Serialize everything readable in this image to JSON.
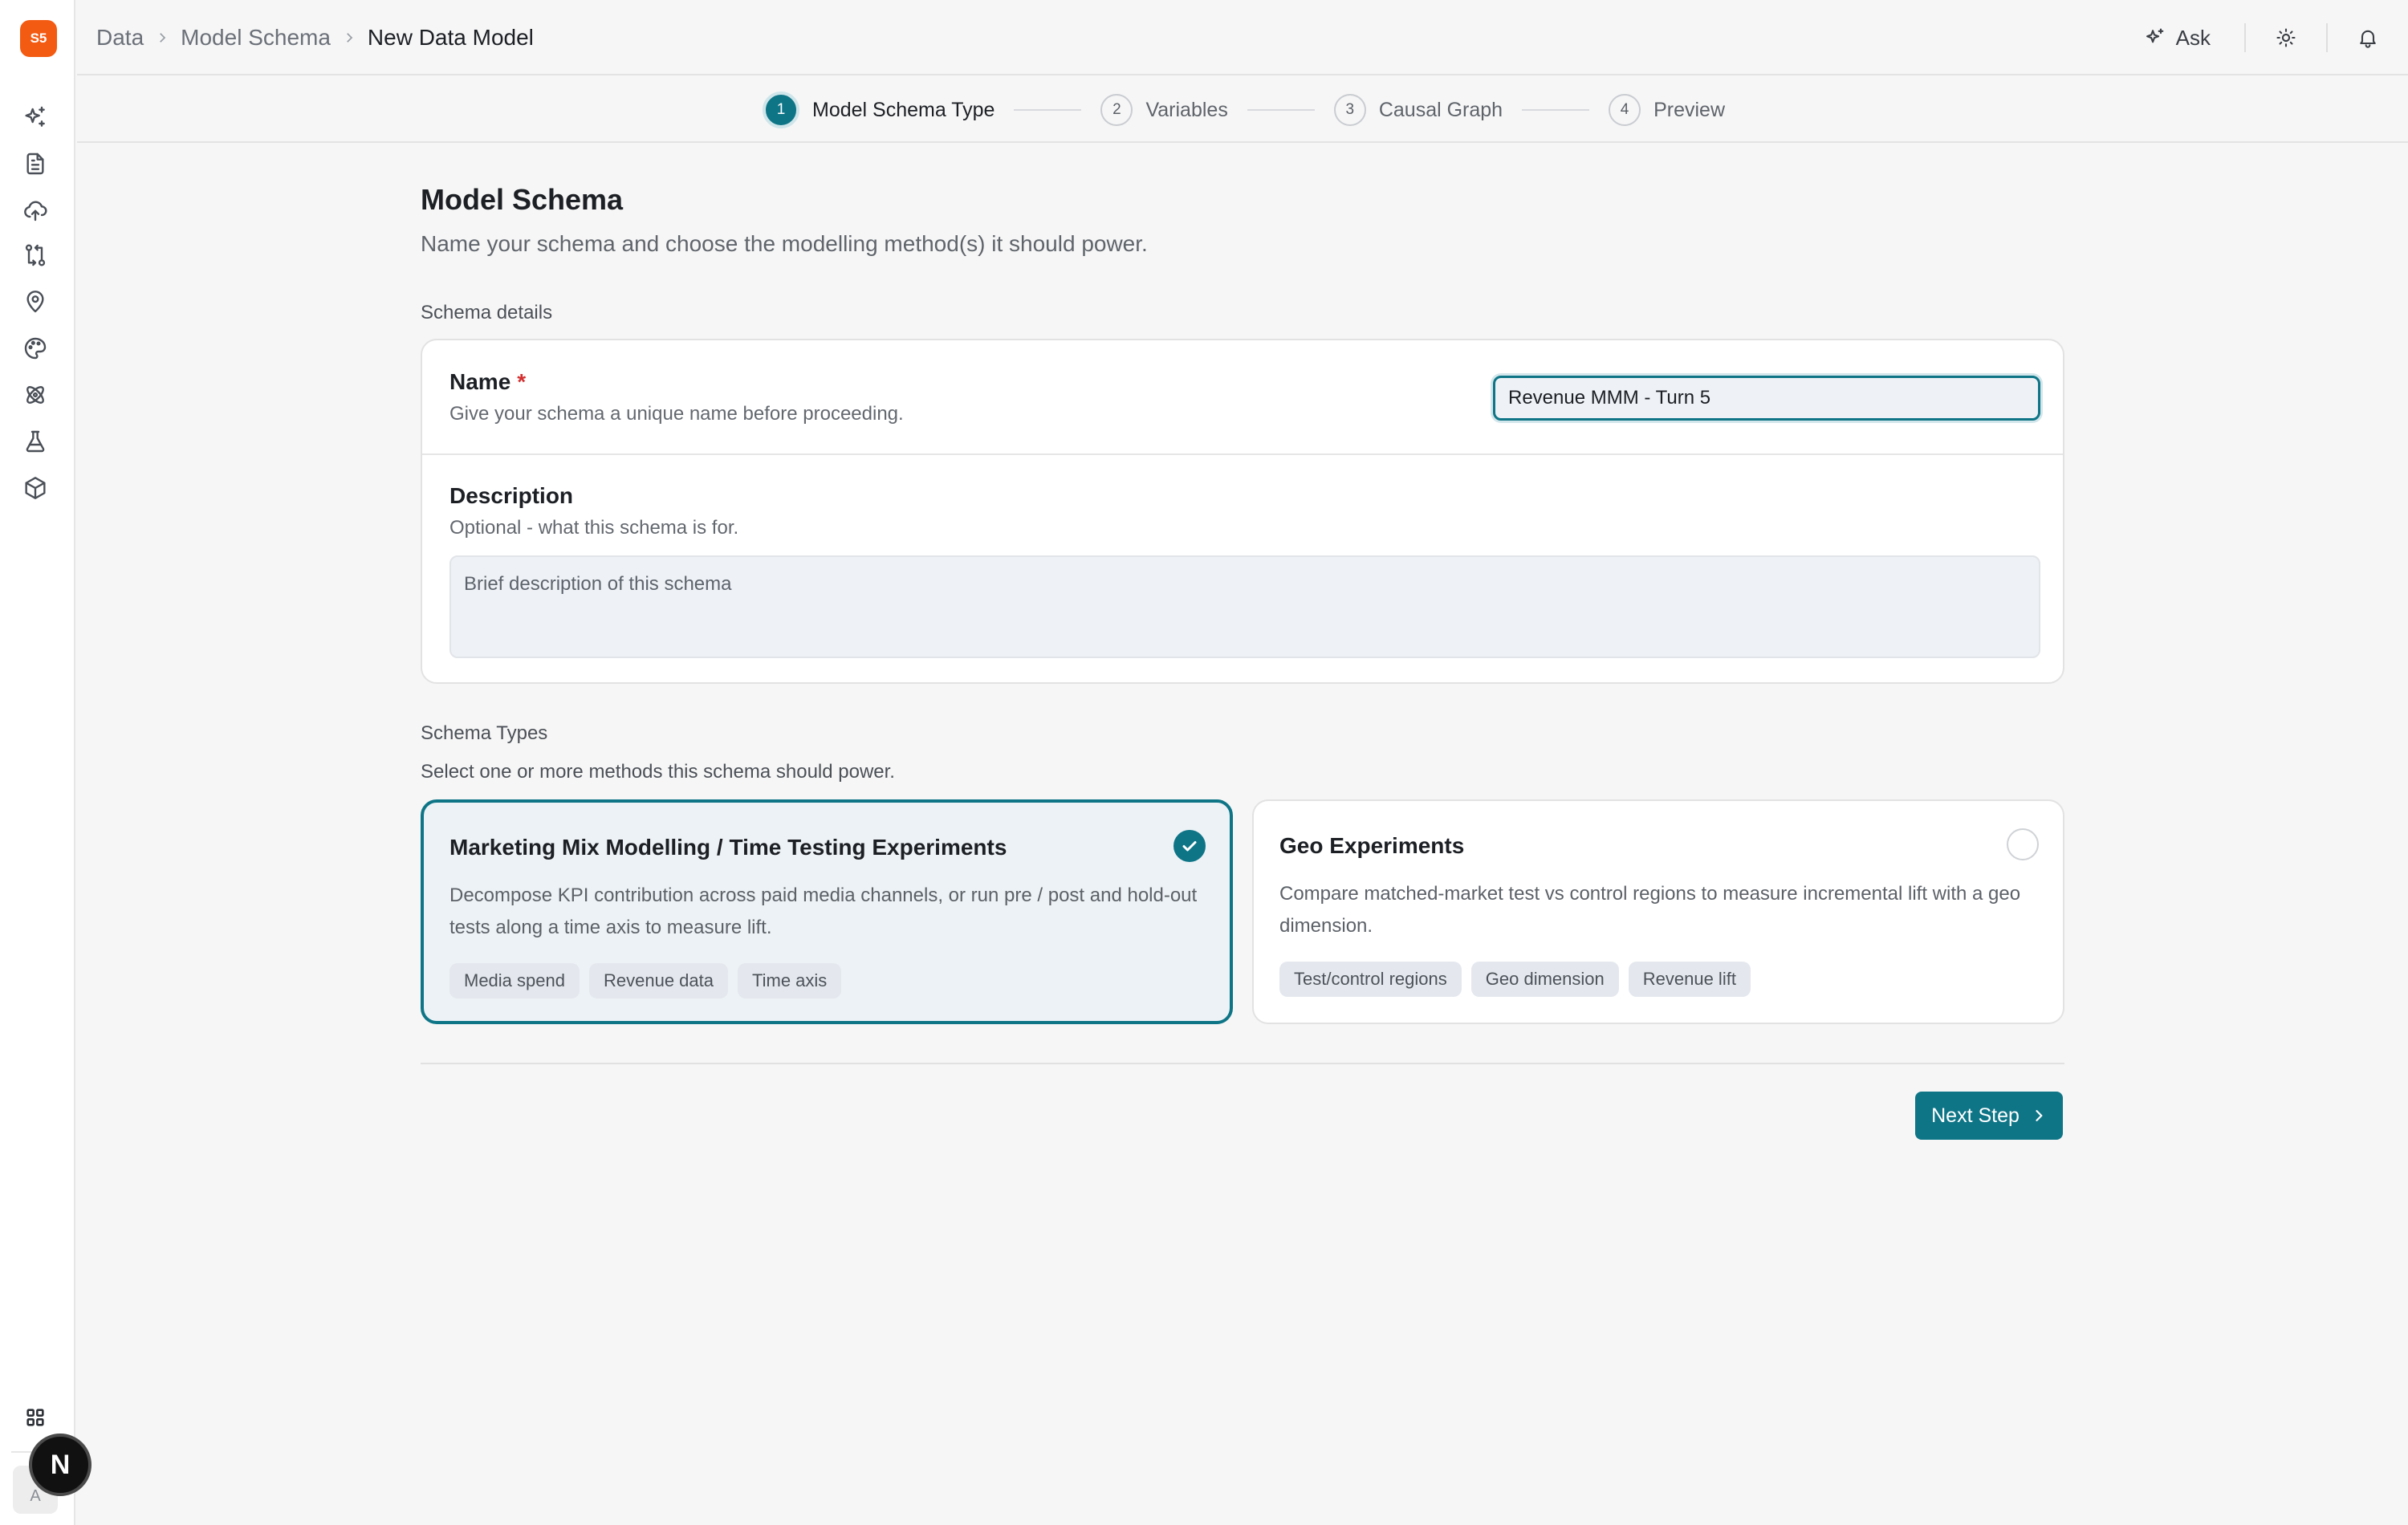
{
  "app": {
    "logo_text": "S5",
    "accent_color": "#0e7587",
    "logo_color": "#f35a12"
  },
  "sidebar": {
    "items": [
      {
        "icon": "sparkles-icon"
      },
      {
        "icon": "document-icon"
      },
      {
        "icon": "cloud-upload-icon"
      },
      {
        "icon": "git-compare-icon"
      },
      {
        "icon": "map-pin-icon"
      },
      {
        "icon": "palette-icon"
      },
      {
        "icon": "atom-icon"
      },
      {
        "icon": "flask-icon"
      },
      {
        "icon": "cube-icon"
      }
    ],
    "apps_icon": "grid-icon",
    "avatar_initial": "A",
    "badge_letter": "N"
  },
  "breadcrumb": {
    "items": [
      "Data",
      "Model Schema"
    ],
    "current": "New Data Model"
  },
  "header_actions": {
    "ask_label": "Ask"
  },
  "stepper": {
    "steps": [
      {
        "number": "1",
        "label": "Model Schema Type"
      },
      {
        "number": "2",
        "label": "Variables"
      },
      {
        "number": "3",
        "label": "Causal Graph"
      },
      {
        "number": "4",
        "label": "Preview"
      }
    ]
  },
  "page": {
    "title": "Model Schema",
    "subtitle": "Name your schema and choose the modelling method(s) it should power."
  },
  "details": {
    "section_label": "Schema details",
    "name": {
      "label": "Name",
      "required_mark": "*",
      "help": "Give your schema a unique name before proceeding.",
      "value": "Revenue MMM - Turn 5"
    },
    "description": {
      "label": "Description",
      "help": "Optional - what this schema is for.",
      "placeholder": "Brief description of this schema"
    }
  },
  "schema_types": {
    "section_label": "Schema Types",
    "section_help": "Select one or more methods this schema should power.",
    "cards": [
      {
        "title": "Marketing Mix Modelling / Time Testing Experiments",
        "description": "Decompose KPI contribution across paid media channels, or run pre / post and hold-out tests along a time axis to measure lift.",
        "chips": [
          "Media spend",
          "Revenue data",
          "Time axis"
        ],
        "selected": true
      },
      {
        "title": "Geo Experiments",
        "description": "Compare matched-market test vs control regions to measure incremental lift with a geo dimension.",
        "chips": [
          "Test/control regions",
          "Geo dimension",
          "Revenue lift"
        ],
        "selected": false
      }
    ]
  },
  "footer": {
    "next_label": "Next Step"
  }
}
